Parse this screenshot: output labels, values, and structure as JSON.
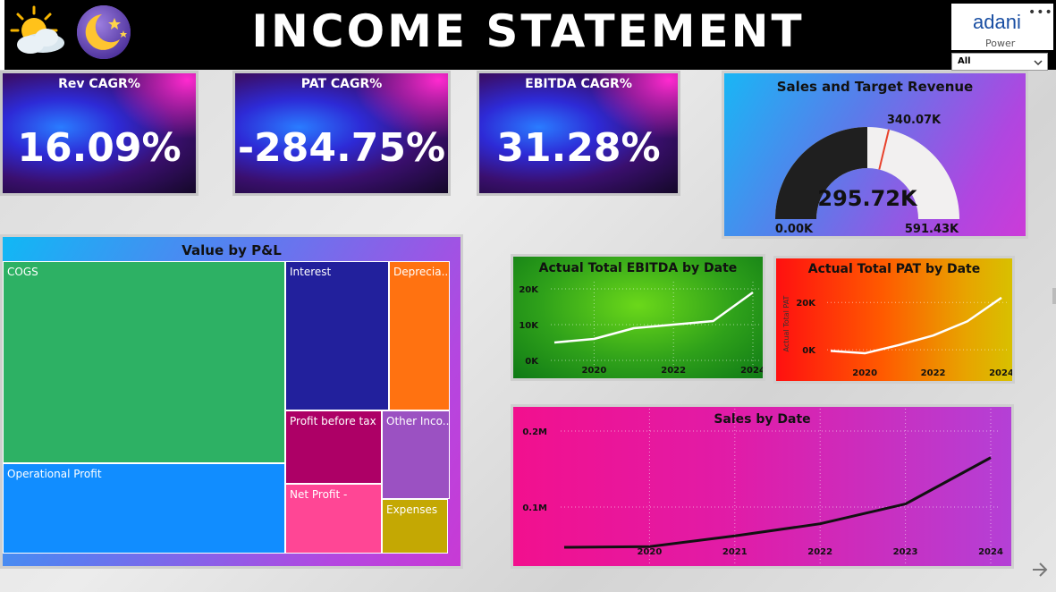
{
  "header": {
    "title": "INCOME STATEMENT",
    "logo_text": "adani",
    "logo_sub": "Power",
    "more_label": "•••",
    "slicer_value": "All",
    "weather_icon": "sun-cloud-icon",
    "moon_icon": "moon-stars-icon"
  },
  "kpis": [
    {
      "label": "Rev CAGR%",
      "value": "16.09%"
    },
    {
      "label": "PAT CAGR%",
      "value": "-284.75%"
    },
    {
      "label": "EBITDA CAGR%",
      "value": "31.28%"
    }
  ],
  "gauge": {
    "title": "Sales and Target Revenue",
    "value_label": "295.72K",
    "min_label": "0.00K",
    "max_label": "591.43K",
    "target_label": "340.07K",
    "value": 295.72,
    "min": 0,
    "max": 591.43,
    "target": 340.07,
    "fill_color": "#1f1f1f",
    "track_color": "#f2f0f0",
    "target_color": "#e8412b"
  },
  "chart_data": [
    {
      "type": "treemap",
      "title": "Value by P&L",
      "items": [
        {
          "name": "COGS",
          "color": "#2db164"
        },
        {
          "name": "Operational Profit",
          "color": "#118dff"
        },
        {
          "name": "Interest",
          "color": "#22209c"
        },
        {
          "name": "Deprecia...",
          "color": "#ff7211"
        },
        {
          "name": "Profit before tax",
          "color": "#ad0066"
        },
        {
          "name": "Other Inco...",
          "color": "#9b51c2"
        },
        {
          "name": "Net Profit -",
          "color": "#ff4695"
        },
        {
          "name": "Expenses",
          "color": "#c4a803"
        }
      ]
    },
    {
      "type": "line",
      "title": "Actual Total EBITDA by Date",
      "x": [
        2019,
        2020,
        2021,
        2022,
        2023,
        2024
      ],
      "values": [
        5000,
        6000,
        9000,
        10000,
        11000,
        19000
      ],
      "xticks": [
        "2020",
        "2022",
        "2024"
      ],
      "yticks": [
        "20K",
        "10K",
        "0K"
      ],
      "ylim": [
        0,
        20000
      ],
      "line_color": "#ffffff"
    },
    {
      "type": "line",
      "title": "Actual Total PAT by Date",
      "ylabel": "Actual Total PAT",
      "x": [
        2019,
        2020,
        2021,
        2022,
        2023,
        2024
      ],
      "values": [
        -500,
        -1500,
        2000,
        6000,
        12000,
        22000
      ],
      "xticks": [
        "2020",
        "2022",
        "2024"
      ],
      "yticks": [
        "20K",
        "0K"
      ],
      "ylim": [
        -3000,
        25000
      ],
      "line_color": "#ffffff"
    },
    {
      "type": "line",
      "title": "Sales by Date",
      "x": [
        2019,
        2020,
        2021,
        2022,
        2023,
        2024
      ],
      "values": [
        0.047,
        0.048,
        0.062,
        0.078,
        0.104,
        0.165
      ],
      "xticks": [
        "2020",
        "2021",
        "2022",
        "2023",
        "2024"
      ],
      "yticks": [
        "0.2M",
        "0.1M"
      ],
      "ylim": [
        0.02,
        0.22
      ],
      "line_color": "#111111"
    }
  ]
}
